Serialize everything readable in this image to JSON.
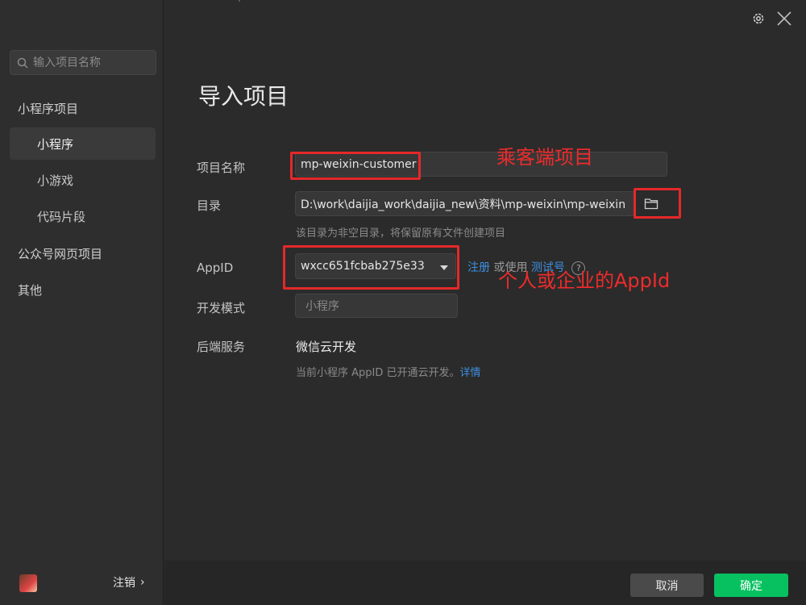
{
  "sidebar": {
    "search_placeholder": "输入项目名称",
    "group_miniprogram": "小程序项目",
    "items": [
      {
        "label": "小程序"
      },
      {
        "label": "小游戏"
      },
      {
        "label": "代码片段"
      }
    ],
    "group_official": "公众号网页项目",
    "group_other": "其他",
    "logout_label": "注销",
    "logout_chevron": "›"
  },
  "main": {
    "title": "导入项目",
    "project_name_label": "项目名称",
    "project_name_value": "mp-weixin-customer",
    "directory_label": "目录",
    "directory_value": "D:\\work\\daijia_work\\daijia_new\\资料\\mp-weixin\\mp-weixin",
    "directory_hint": "该目录为非空目录，将保留原有文件创建项目",
    "appid_label": "AppID",
    "appid_value": "wxcc651fcbab275e33",
    "register_link": "注册",
    "or_use": "或使用",
    "test_account_link": "测试号",
    "dev_mode_label": "开发模式",
    "dev_mode_value": "小程序",
    "backend_label": "后端服务",
    "backend_value": "微信云开发",
    "backend_hint": "当前小程序 AppID 已开通云开发。",
    "backend_detail_link": "详情"
  },
  "annotations": {
    "passenger": "乘客端项目",
    "appid_note": "个人或企业的AppId",
    "color": "#e5282a"
  },
  "footer": {
    "cancel_label": "取消",
    "ok_label": "确定"
  },
  "colors": {
    "accent": "#07c160",
    "link": "#3d8fe0"
  }
}
